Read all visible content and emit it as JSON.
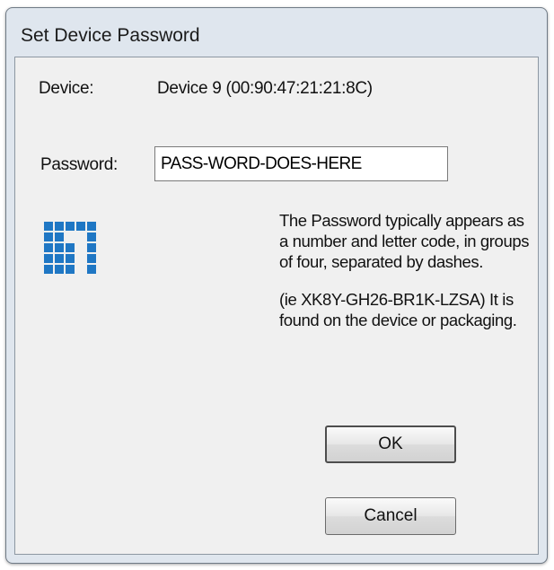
{
  "window": {
    "title": "Set Device Password"
  },
  "device": {
    "label": "Device:",
    "value": "Device 9  (00:90:47:21:21:8C)"
  },
  "password": {
    "label": "Password:",
    "value": "PASS-WORD-DOES-HERE"
  },
  "help": {
    "paragraph1": "The Password typically appears as a number and letter code, in groups of four, separated by dashes.",
    "paragraph2": "(ie XK8Y-GH26-BR1K-LZSA) It is found on the device or packaging."
  },
  "buttons": {
    "ok_label": "OK",
    "cancel_label": "Cancel"
  },
  "icons": {
    "logo": "levelone-logo-icon"
  },
  "colors": {
    "logo_blue": "#1f77c4",
    "window_frame": "#dfe6ee",
    "dialog_background": "#f0f0f0"
  }
}
